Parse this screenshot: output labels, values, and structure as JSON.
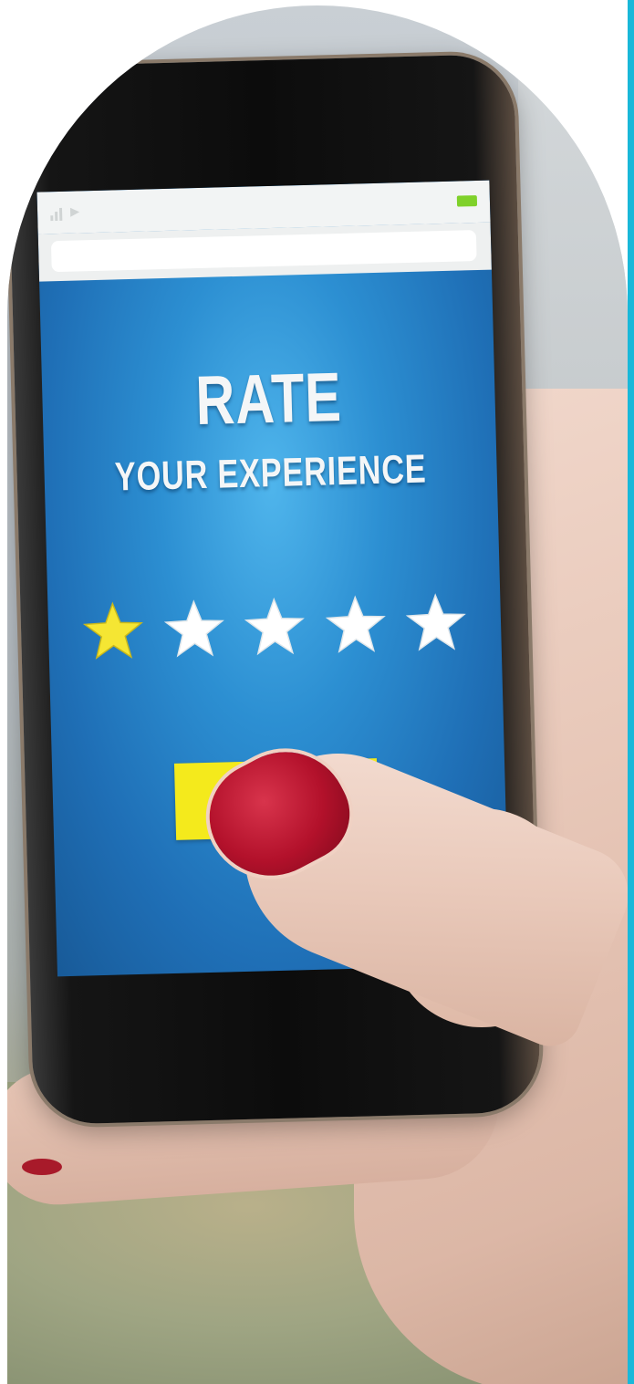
{
  "image": {
    "type": "photo",
    "accent_stripe_color": "#19b8d9"
  },
  "phone_screen": {
    "title": "RATE",
    "subtitle": "YOUR EXPERIENCE",
    "rating": {
      "selected": 1,
      "max": 5,
      "filled_color": "#f5e633",
      "empty_color": "#ffffff"
    },
    "button_color": "#f4ea1c",
    "background_color": "#2c8fd2",
    "status_bar": {
      "signal_icon": "signal-icon",
      "battery_icon": "battery-icon",
      "battery_color": "#7fd12a"
    }
  },
  "nail_color": "#b3112b"
}
